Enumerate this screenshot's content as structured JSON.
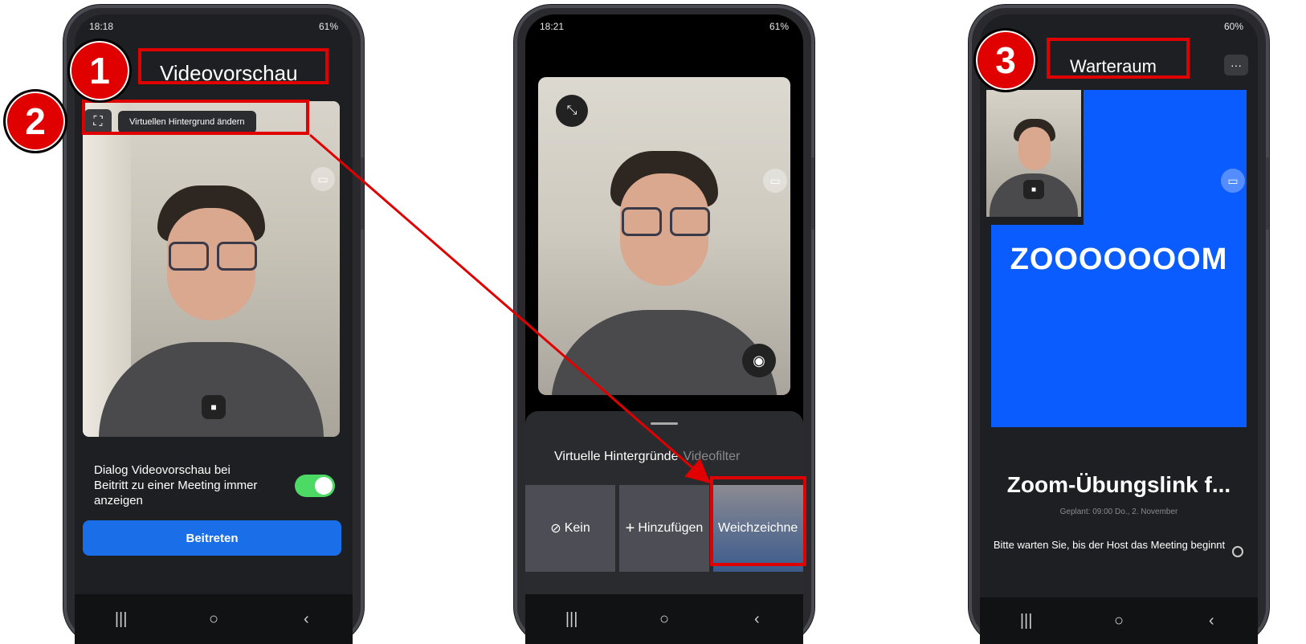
{
  "phone1": {
    "status_time": "18:18",
    "status_right": "61%",
    "title": "Videovorschau",
    "badge1": "1",
    "badge2": "2",
    "tooltip": "Virtuellen Hintergrund ändern",
    "toggle_text": "Dialog Videovorschau bei Beitritt zu einer Meeting immer anzeigen",
    "toggle_on": true,
    "join_button": "Beitreten"
  },
  "phone2": {
    "status_time": "18:21",
    "status_right": "61%",
    "tab_virtual": "Virtuelle Hintergründe",
    "tab_filter": "Videofilter",
    "tiles": [
      "Kein",
      "Hinzufügen",
      "Weichzeichne"
    ]
  },
  "phone3": {
    "status_right": "60%",
    "badge3": "3",
    "title": "Warteraum",
    "more": "···",
    "logo": "ZOOOOOOOM",
    "meeting_title": "Zoom-Übungslink f...",
    "scheduled": "Geplant: 09:00 Do., 2. November",
    "waiting_text": "Bitte warten Sie, bis der Host das Meeting beginnt"
  },
  "colors": {
    "annotation": "#e00000",
    "join_blue": "#1a6fe8",
    "zoom_blue": "#0b5cff",
    "toggle_green": "#4cd964"
  },
  "icons": {
    "nav_recent": "|||",
    "nav_home": "○",
    "nav_back": "‹"
  }
}
